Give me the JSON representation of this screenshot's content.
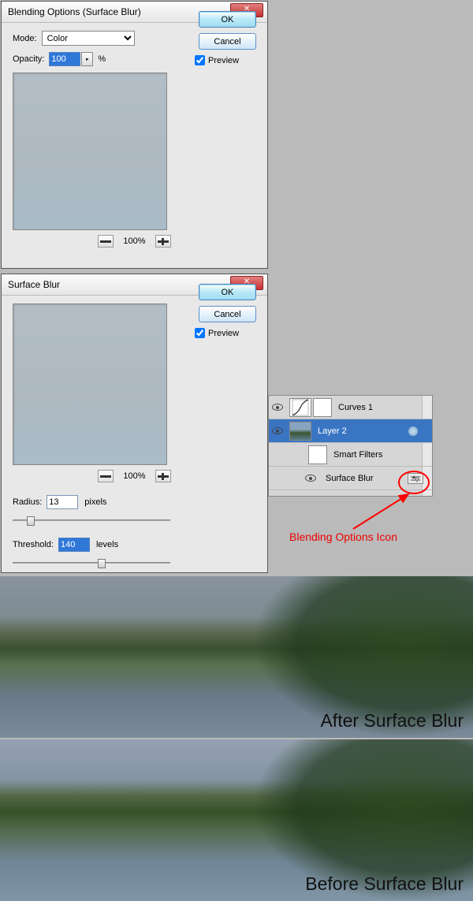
{
  "dialog1": {
    "title": "Blending Options (Surface Blur)",
    "modeLabel": "Mode:",
    "modeValue": "Color",
    "opacityLabel": "Opacity:",
    "opacityValue": "100",
    "opacityUnit": "%",
    "ok": "OK",
    "cancel": "Cancel",
    "preview": "Preview",
    "zoom": "100%"
  },
  "dialog2": {
    "title": "Surface Blur",
    "ok": "OK",
    "cancel": "Cancel",
    "preview": "Preview",
    "zoom": "100%",
    "radiusLabel": "Radius:",
    "radiusValue": "13",
    "radiusUnit": "pixels",
    "thresholdLabel": "Threshold:",
    "thresholdValue": "140",
    "thresholdUnit": "levels"
  },
  "layers": {
    "curves": "Curves 1",
    "layer2": "Layer 2",
    "smartFilters": "Smart Filters",
    "surfaceBlur": "Surface Blur"
  },
  "annotation": "Blending Options Icon",
  "imgA": "After Surface Blur",
  "imgB": "Before Surface Blur"
}
